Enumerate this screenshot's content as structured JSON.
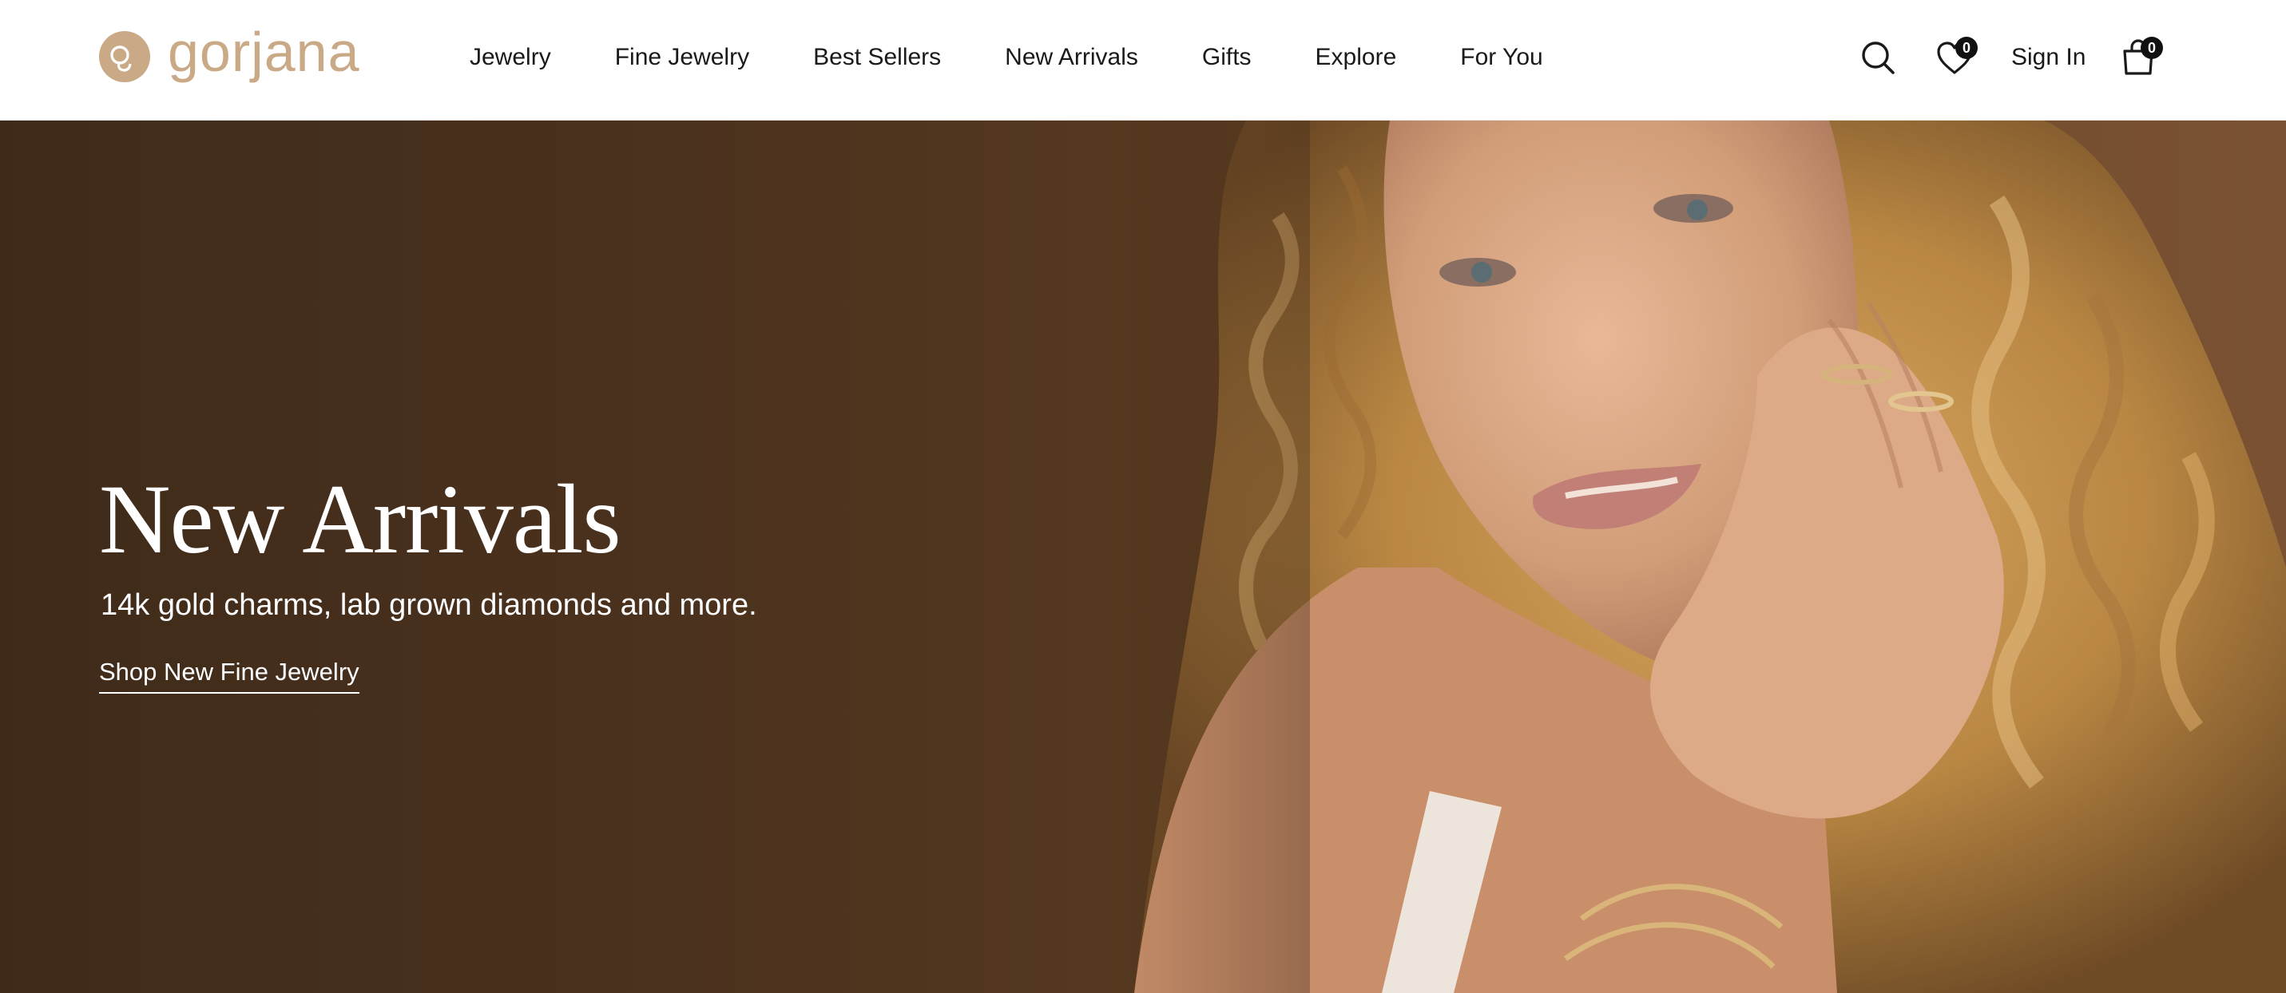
{
  "brand": {
    "name": "gorjana",
    "accent_color": "#c9a986"
  },
  "nav": {
    "items": [
      {
        "label": "Jewelry"
      },
      {
        "label": "Fine Jewelry"
      },
      {
        "label": "Best Sellers"
      },
      {
        "label": "New Arrivals"
      },
      {
        "label": "Gifts"
      },
      {
        "label": "Explore"
      },
      {
        "label": "For You"
      }
    ]
  },
  "utilities": {
    "search_icon": "search-icon",
    "wishlist_icon": "heart-icon",
    "wishlist_count": "0",
    "sign_in_label": "Sign In",
    "bag_icon": "shopping-bag-icon",
    "bag_count": "0"
  },
  "hero": {
    "title": "New Arrivals",
    "subtitle": "14k gold charms, lab grown diamonds and more.",
    "cta_label": "Shop New Fine Jewelry",
    "background_color": "#4b321e"
  }
}
